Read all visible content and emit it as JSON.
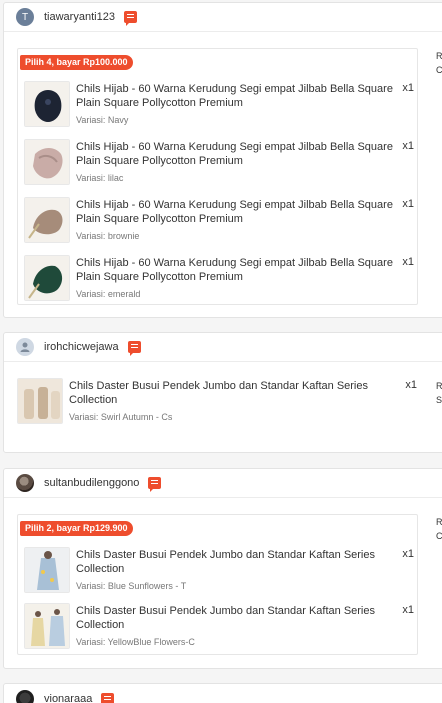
{
  "orders": [
    {
      "username": "tiawaryanti123",
      "avatar_letter": "T",
      "bundle_label": "Pilih 4, bayar Rp100.000",
      "side": [
        "R",
        "C"
      ],
      "items": [
        {
          "title": "Chils Hijab - 60 Warna Kerudung Segi empat Jilbab Bella Square Plain Square Pollycotton Premium",
          "variant": "Variasi: Navy",
          "qty": "x1",
          "thumb_color": "#1d2433"
        },
        {
          "title": "Chils Hijab - 60 Warna Kerudung Segi empat Jilbab Bella Square Plain Square Pollycotton Premium",
          "variant": "Variasi: lilac",
          "qty": "x1",
          "thumb_color": "#c9aca7"
        },
        {
          "title": "Chils Hijab - 60 Warna Kerudung Segi empat Jilbab Bella Square Plain Square Pollycotton Premium",
          "variant": "Variasi: brownie",
          "qty": "x1",
          "thumb_color": "#a68c7a"
        },
        {
          "title": "Chils Hijab - 60 Warna Kerudung Segi empat Jilbab Bella Square Plain Square Pollycotton Premium",
          "variant": "Variasi: emerald",
          "qty": "x1",
          "thumb_color": "#1f4a3a"
        }
      ]
    },
    {
      "username": "irohchicwejawa",
      "side": [
        "R",
        "S"
      ],
      "items": [
        {
          "title": "Chils Daster Busui Pendek Jumbo dan Standar Kaftan Series Collection",
          "variant": "Variasi: Swirl Autumn - Cs",
          "qty": "x1",
          "thumb_color": "#d9c7b0"
        }
      ]
    },
    {
      "username": "sultanbudilenggono",
      "bundle_label": "Pilih 2, bayar Rp129.900",
      "side": [
        "R",
        "C"
      ],
      "items": [
        {
          "title": "Chils Daster Busui Pendek Jumbo dan Standar Kaftan Series Collection",
          "variant": "Variasi: Blue Sunflowers - T",
          "qty": "x1",
          "thumb_color": "#a8c0d6"
        },
        {
          "title": "Chils Daster Busui Pendek Jumbo dan Standar Kaftan Series Collection",
          "variant": "Variasi: YellowBlue Flowers-C",
          "qty": "x1",
          "thumb_color": "#e6d7a3"
        }
      ]
    },
    {
      "username": "vionaraaa"
    }
  ]
}
